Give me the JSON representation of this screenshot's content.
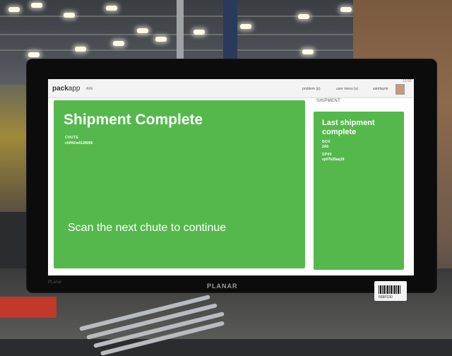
{
  "app": {
    "logo_pack": "pack",
    "logo_app": "app",
    "station": "AFE",
    "nav": {
      "problem": "problem (p)",
      "user_menu": "user menu (u)",
      "username": "samfaymr"
    },
    "time": "13:50"
  },
  "main": {
    "title": "Shipment Complete",
    "chute_label": "CHUTE",
    "chute_value": "chPAFw011B006",
    "prompt": "Scan the next chute to continue"
  },
  "shipment_panel": {
    "header": "SHIPMENT",
    "heading": "Last shipment complete",
    "box_label": "BOX",
    "box_value": "2A6",
    "sp00_label": "SP00",
    "sp00_value": "sp57b25aq18"
  },
  "monitor": {
    "brand": "PLANAR",
    "model": "PLanar"
  },
  "sticker": {
    "text": "668F530"
  },
  "colors": {
    "panel_green": "#55b84c",
    "header_bg": "#f3f3f3"
  }
}
